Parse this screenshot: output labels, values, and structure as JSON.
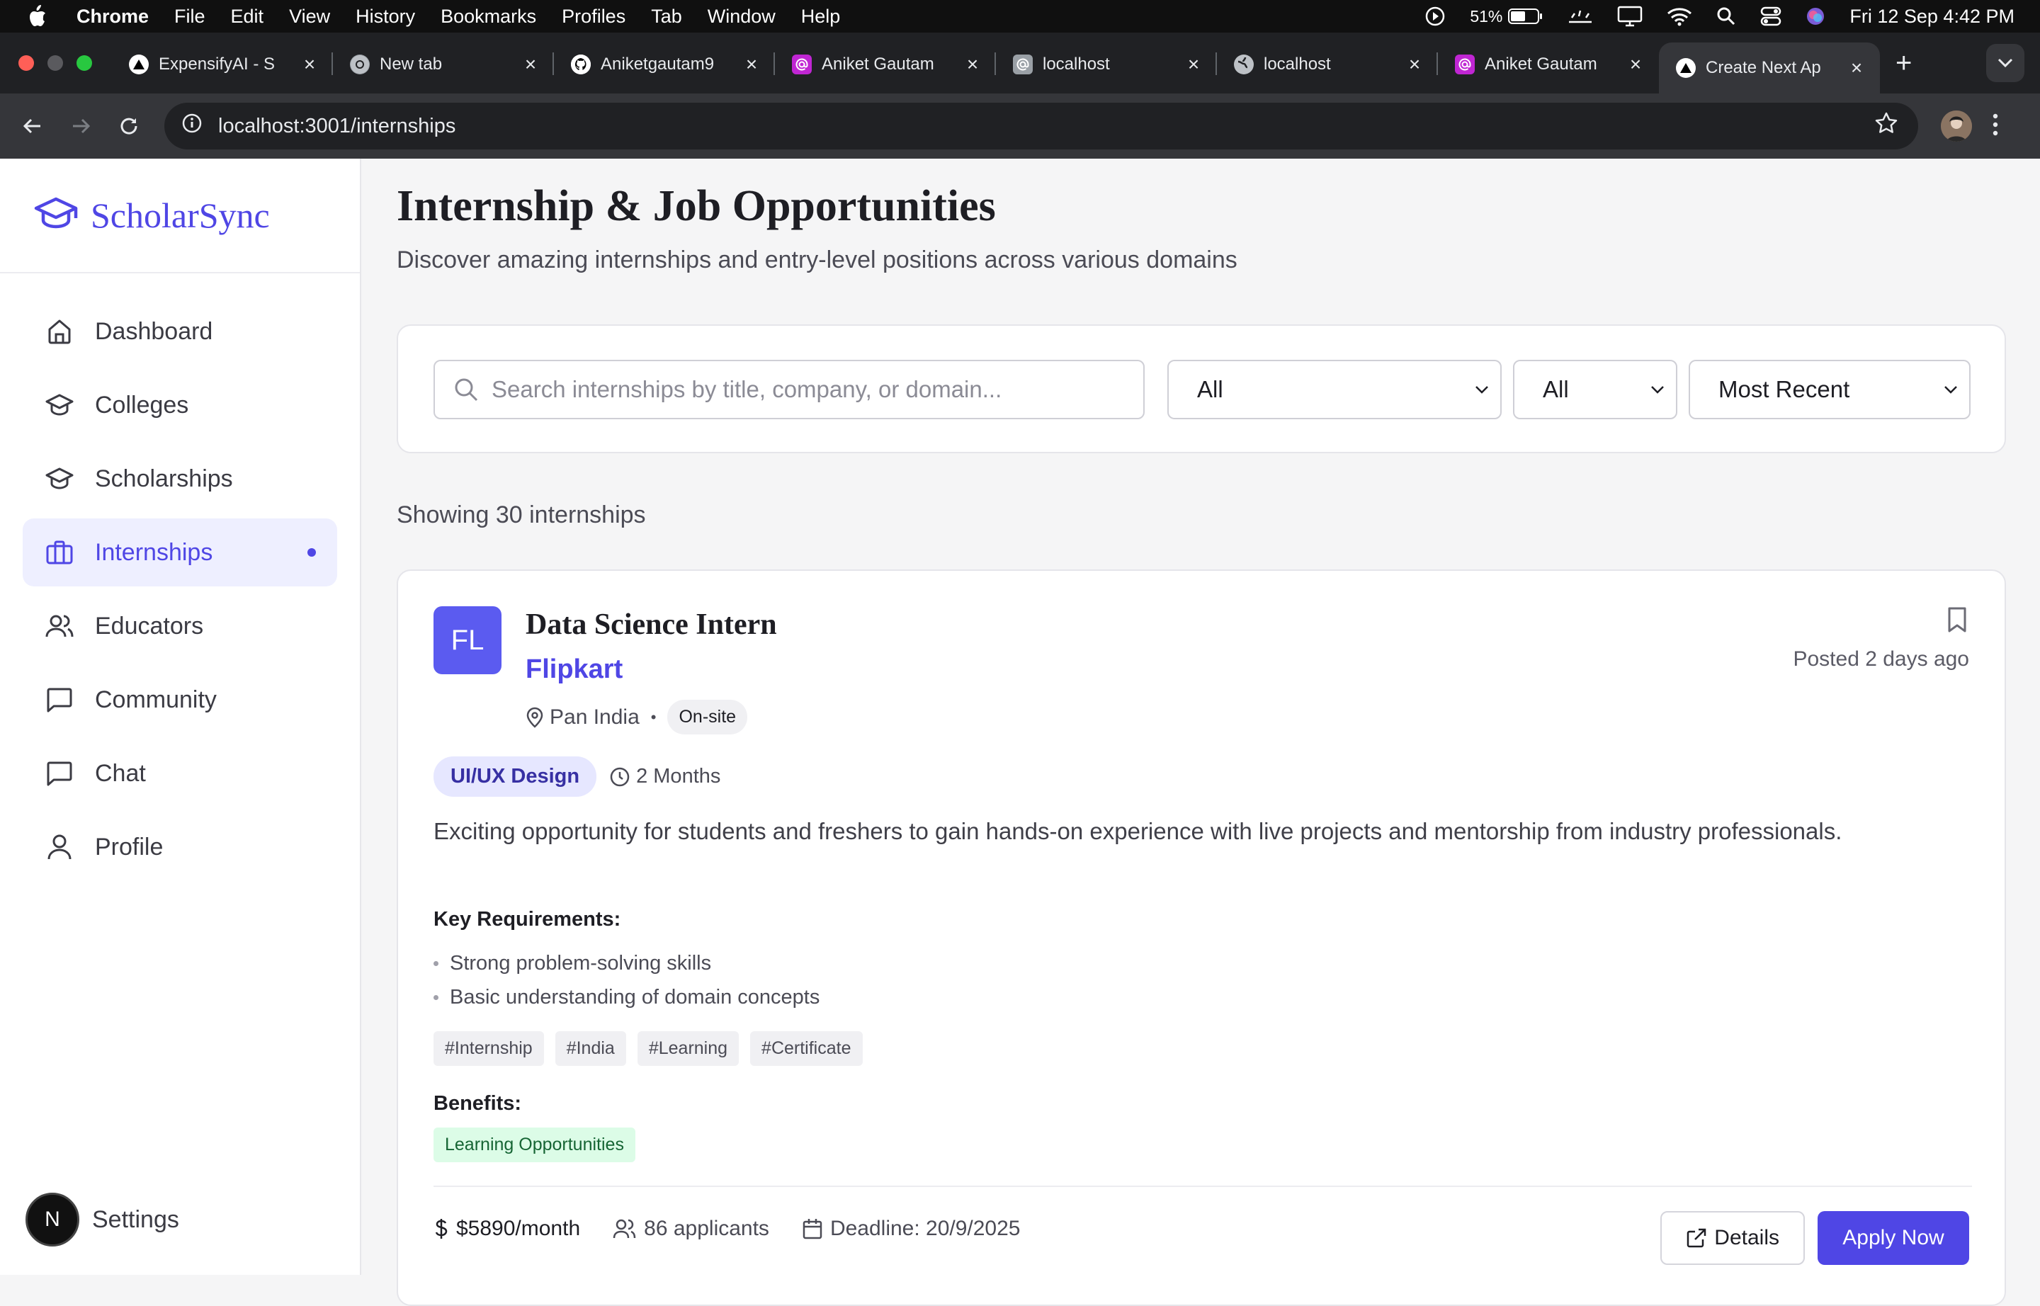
{
  "menubar": {
    "app": "Chrome",
    "items": [
      "File",
      "Edit",
      "View",
      "History",
      "Bookmarks",
      "Profiles",
      "Tab",
      "Window",
      "Help"
    ],
    "battery": "51%",
    "datetime": "Fri 12 Sep  4:42 PM"
  },
  "tabs": [
    {
      "title": "ExpensifyAI - S",
      "icon": "triangle-icon"
    },
    {
      "title": "New tab",
      "icon": "chrome-icon"
    },
    {
      "title": "Aniketgautam9",
      "icon": "github-icon"
    },
    {
      "title": "Aniket Gautam",
      "icon": "at-icon"
    },
    {
      "title": "localhost",
      "icon": "at-icon"
    },
    {
      "title": "localhost",
      "icon": "globe-icon"
    },
    {
      "title": "Aniket Gautam",
      "icon": "at-icon"
    },
    {
      "title": "Create Next Ap",
      "icon": "triangle-icon",
      "active": true
    }
  ],
  "address": {
    "url": "localhost:3001/internships"
  },
  "brand": {
    "name": "ScholarSync",
    "color": "#4f46e5"
  },
  "nav": [
    {
      "label": "Dashboard",
      "icon": "home-icon"
    },
    {
      "label": "Colleges",
      "icon": "graduation-cap-icon"
    },
    {
      "label": "Scholarships",
      "icon": "graduation-cap-icon"
    },
    {
      "label": "Internships",
      "icon": "briefcase-icon",
      "active": true
    },
    {
      "label": "Educators",
      "icon": "users-icon"
    },
    {
      "label": "Community",
      "icon": "message-square-icon"
    },
    {
      "label": "Chat",
      "icon": "message-square-icon"
    },
    {
      "label": "Profile",
      "icon": "user-icon"
    }
  ],
  "settings": {
    "badge": "N",
    "label": "Settings"
  },
  "page": {
    "title": "Internship & Job Opportunities",
    "subtitle": "Discover amazing internships and entry-level positions across various domains"
  },
  "filters": {
    "search_placeholder": "Search internships by title, company, or domain...",
    "domain": "All",
    "type": "All",
    "sort": "Most Recent"
  },
  "results": {
    "showing": "Showing 30 internships"
  },
  "card": {
    "logo": "FL",
    "title": "Data Science Intern",
    "company": "Flipkart",
    "location": "Pan India",
    "mode": "On-site",
    "posted": "Posted 2 days ago",
    "domain": "UI/UX Design",
    "duration": "2 Months",
    "description": "Exciting opportunity for students and freshers to gain hands-on experience with live projects and mentorship from industry professionals.",
    "requirements_heading": "Key Requirements:",
    "requirements": [
      "Strong problem-solving skills",
      "Basic understanding of domain concepts"
    ],
    "tags": [
      "#Internship",
      "#India",
      "#Learning",
      "#Certificate"
    ],
    "benefits_heading": "Benefits:",
    "benefits": [
      "Learning Opportunities"
    ],
    "salary": "$5890/month",
    "applicants": "86 applicants",
    "deadline": "Deadline: 20/9/2025",
    "details_label": "Details",
    "apply_label": "Apply Now"
  }
}
